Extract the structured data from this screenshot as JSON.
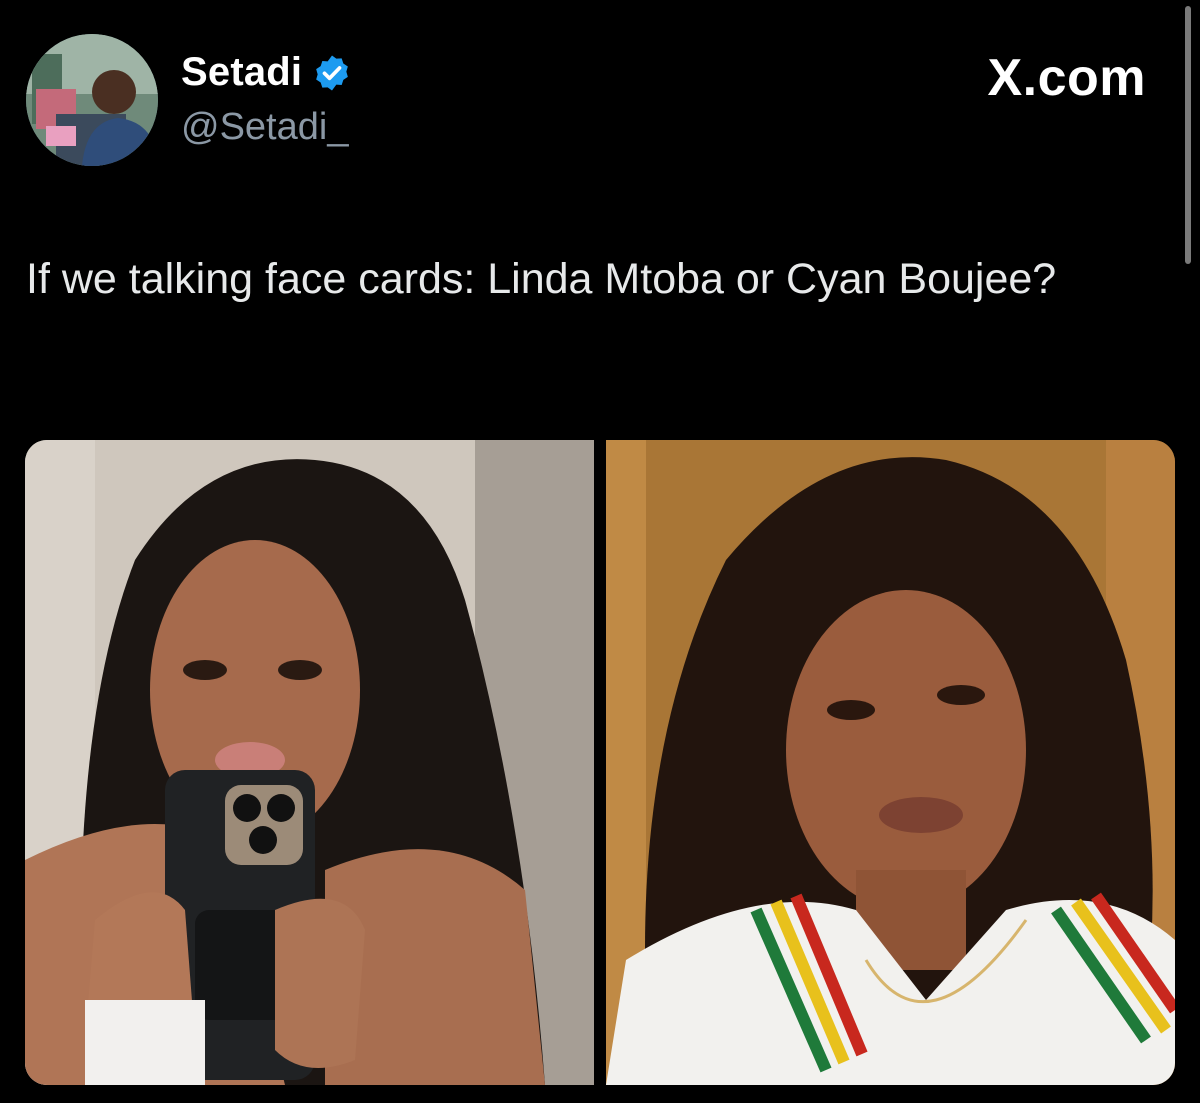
{
  "brand": "X.com",
  "author": {
    "display_name": "Setadi",
    "handle": "@Setadi_",
    "verified": true,
    "avatar_icon": "profile-photo"
  },
  "tweet": {
    "text": "If we talking face cards: Linda Mtoba or Cyan Boujee?"
  },
  "media": {
    "photos": [
      {
        "icon": "photo-woman-braids-mirror-selfie"
      },
      {
        "icon": "photo-woman-dark-hair-portrait"
      }
    ]
  },
  "colors": {
    "background": "#000000",
    "text_primary": "#e7e9ea",
    "text_secondary": "#8b98a5",
    "verified_blue": "#1d9bf0"
  }
}
